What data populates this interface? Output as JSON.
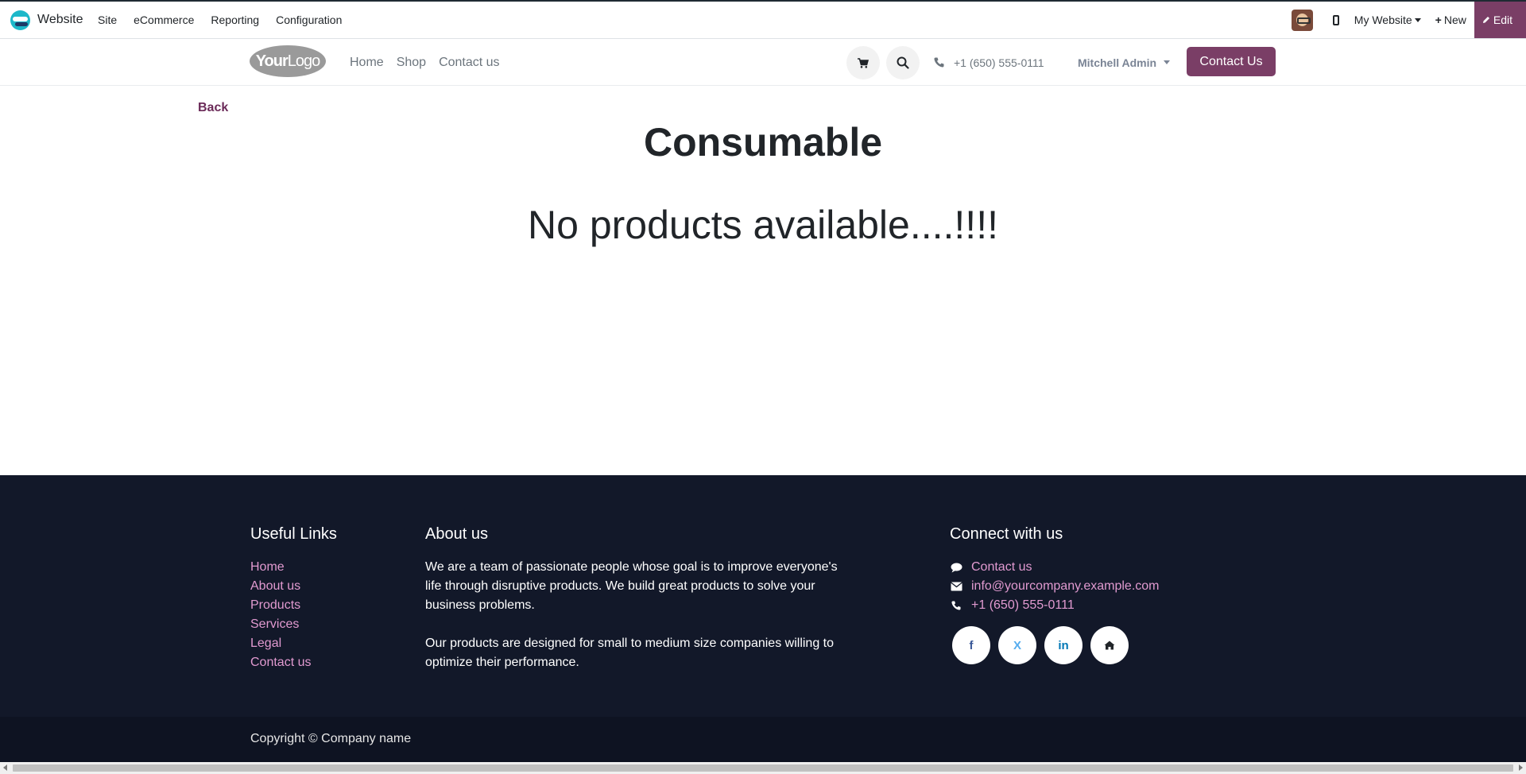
{
  "topbar": {
    "app_name": "Website",
    "menu": [
      "Site",
      "eCommerce",
      "Reporting",
      "Configuration"
    ],
    "website_selector": "My Website",
    "new_label": "New",
    "edit_label": "Edit"
  },
  "header": {
    "logo_bold": "Your",
    "logo_light": "Logo",
    "nav": [
      "Home",
      "Shop",
      "Contact us"
    ],
    "phone": "+1 (650) 555-0111",
    "user": "Mitchell Admin",
    "contact_button": "Contact Us"
  },
  "main": {
    "back": "Back",
    "title": "Consumable",
    "empty_message": "No products available....!!!!"
  },
  "footer": {
    "useful_links_title": "Useful Links",
    "useful_links": [
      "Home",
      "About us",
      "Products",
      "Services",
      "Legal",
      "Contact us"
    ],
    "about_title": "About us",
    "about_p1": "We are a team of passionate people whose goal is to improve everyone's life through disruptive products. We build great products to solve your business problems.",
    "about_p2": "Our products are designed for small to medium size companies willing to optimize their performance.",
    "connect_title": "Connect with us",
    "connect_contact": "Contact us",
    "connect_email": "info@yourcompany.example.com",
    "connect_phone": "+1 (650) 555-0111",
    "social": {
      "facebook": "f",
      "x": "X",
      "linkedin": "in"
    },
    "copyright": "Copyright © Company name"
  },
  "colors": {
    "brand_primary": "#7a3e66",
    "footer_bg": "#121829",
    "footer_link": "#e19ad0"
  },
  "icons": [
    "website-logo-icon",
    "device-icon",
    "caret-down-icon",
    "plus-icon",
    "pencil-icon",
    "cart-icon",
    "search-icon",
    "phone-icon",
    "comment-icon",
    "envelope-icon",
    "facebook-icon",
    "x-icon",
    "linkedin-icon",
    "home-icon"
  ]
}
